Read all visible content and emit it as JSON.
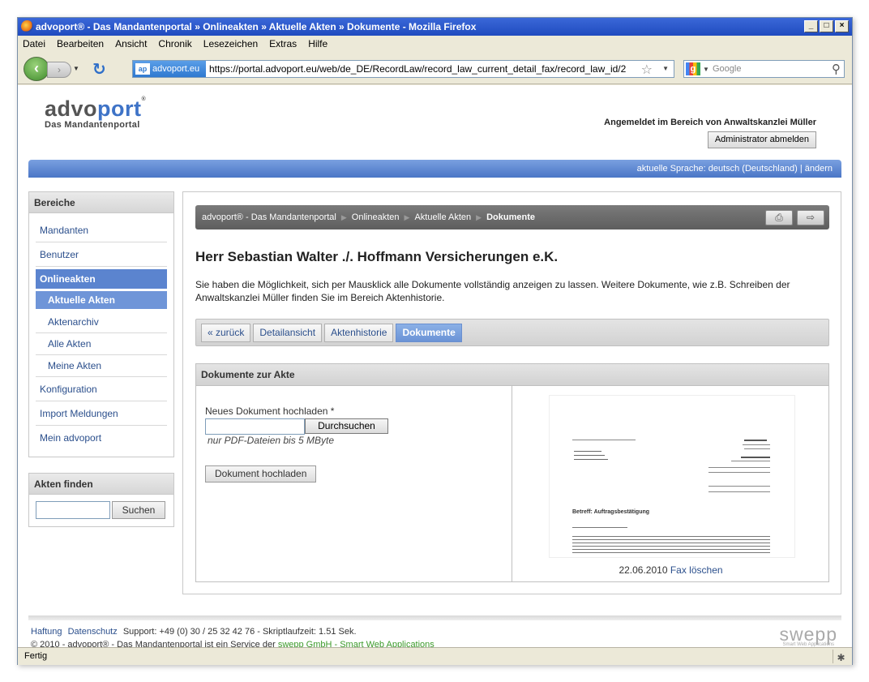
{
  "window": {
    "title": "advoport® - Das Mandantenportal » Onlineakten » Aktuelle Akten » Dokumente - Mozilla Firefox"
  },
  "menu": [
    "Datei",
    "Bearbeiten",
    "Ansicht",
    "Chronik",
    "Lesezeichen",
    "Extras",
    "Hilfe"
  ],
  "browser": {
    "site_badge": "advoport.eu",
    "site_badge_icon": "ap",
    "url": "https://portal.advoport.eu/web/de_DE/RecordLaw/record_law_current_detail_fax/record_law_id/2",
    "search_placeholder": "Google"
  },
  "header": {
    "logo_brand_a": "advo",
    "logo_brand_b": "port",
    "logo_reg": "®",
    "logo_sub": "Das Mandantenportal",
    "login_info": "Angemeldet im Bereich von Anwaltskanzlei Müller",
    "logout_label": "Administrator abmelden",
    "language": "aktuelle Sprache: deutsch (Deutschland) | ändern"
  },
  "sidebar": {
    "title": "Bereiche",
    "items": {
      "mandanten": "Mandanten",
      "benutzer": "Benutzer",
      "onlineakten": "Onlineakten",
      "aktuelle": "Aktuelle Akten",
      "archiv": "Aktenarchiv",
      "alle": "Alle Akten",
      "meine": "Meine Akten",
      "konfiguration": "Konfiguration",
      "import": "Import Meldungen",
      "mein": "Mein advoport"
    },
    "find_title": "Akten finden",
    "find_button": "Suchen"
  },
  "breadcrumb": [
    "advoport® - Das Mandantenportal",
    "Onlineakten",
    "Aktuelle Akten",
    "Dokumente"
  ],
  "main": {
    "headline": "Herr Sebastian Walter ./. Hoffmann Versicherungen e.K.",
    "intro": "Sie haben die Möglichkeit, sich per Mausklick alle Dokumente vollständig anzeigen zu lassen. Weitere Dokumente, wie z.B. Schreiben der Anwaltskanzlei Müller finden Sie im Bereich Aktenhistorie.",
    "tabs": {
      "back": "« zurück",
      "detail": "Detailansicht",
      "history": "Aktenhistorie",
      "docs": "Dokumente"
    },
    "docs_title": "Dokumente zur Akte",
    "upload_label": "Neues Dokument hochladen *",
    "browse_label": "Durchsuchen",
    "upload_hint": "nur PDF-Dateien bis 5 MByte",
    "upload_button": "Dokument hochladen",
    "fax_date": "22.06.2010",
    "fax_delete": "Fax löschen",
    "fax_subject": "Betreff: Auftragsbestätigung"
  },
  "footer": {
    "haftung": "Haftung",
    "datenschutz": "Datenschutz",
    "support": "Support: +49 (0) 30 / 25 32 42 76 - Skriptlaufzeit: 1.51 Sek.",
    "copyright": "© 2010 - advoport® - Das Mandantenportal ist ein Service der ",
    "swepp_link": "swepp GmbH - Smart Web Applications",
    "swepp_logo": "swepp",
    "swepp_tag": "Smart Web Applications"
  },
  "status": "Fertig"
}
